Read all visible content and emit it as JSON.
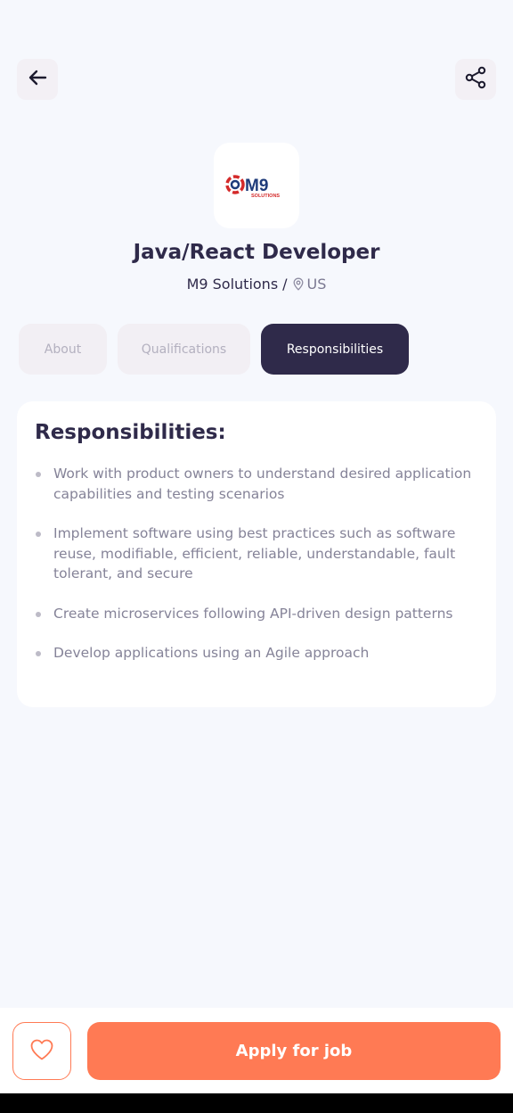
{
  "header": {
    "back_icon": "arrow-left-icon",
    "share_icon": "share-icon"
  },
  "company": {
    "logo_text": "M9",
    "logo_subtext": "SOLUTIONS",
    "name": "M9 Solutions",
    "location": "US",
    "location_icon": "map-pin-icon"
  },
  "job": {
    "title": "Java/React Developer"
  },
  "tabs": [
    {
      "label": "About"
    },
    {
      "label": "Qualifications"
    },
    {
      "label": "Responsibilities"
    }
  ],
  "active_tab": "Responsibilities",
  "responsibilities": {
    "heading": "Responsibilities:",
    "items": [
      "Work with product owners to understand desired application capabilities and testing scenarios",
      "Implement software using best practices such as software reuse, modifiable, efficient, reliable, understandable, fault tolerant, and secure",
      "Create microservices following API-driven design patterns",
      "Develop applications using an Agile approach"
    ]
  },
  "footer": {
    "favorite_icon": "heart-icon",
    "apply_label": "Apply for job"
  },
  "colors": {
    "primary_dark": "#2f2a4a",
    "accent": "#ff7a54",
    "background": "#f6f8fd"
  }
}
